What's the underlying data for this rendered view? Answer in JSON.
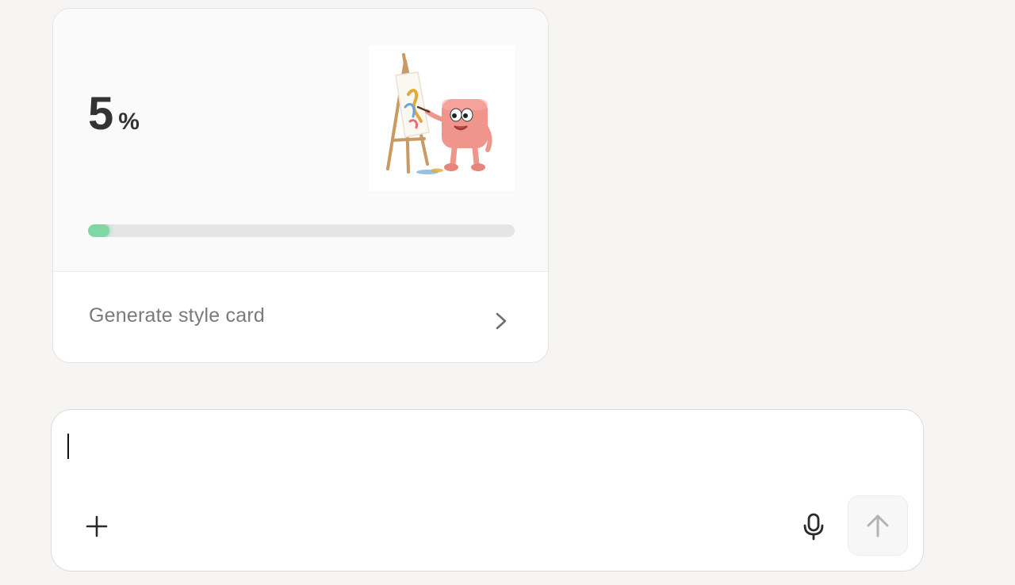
{
  "progress_card": {
    "percent_value": "5",
    "percent_sign": "%",
    "progress_fraction": 0.05,
    "progress_color": "#7fd7a3",
    "mascot": "painting-mascot-illustration",
    "action_label": "Generate style card",
    "action_icon": "chevron-right-icon"
  },
  "composer": {
    "input_value": "",
    "input_placeholder": "",
    "attach_icon": "plus-icon",
    "voice_icon": "microphone-icon",
    "send_icon": "arrow-up-icon"
  }
}
